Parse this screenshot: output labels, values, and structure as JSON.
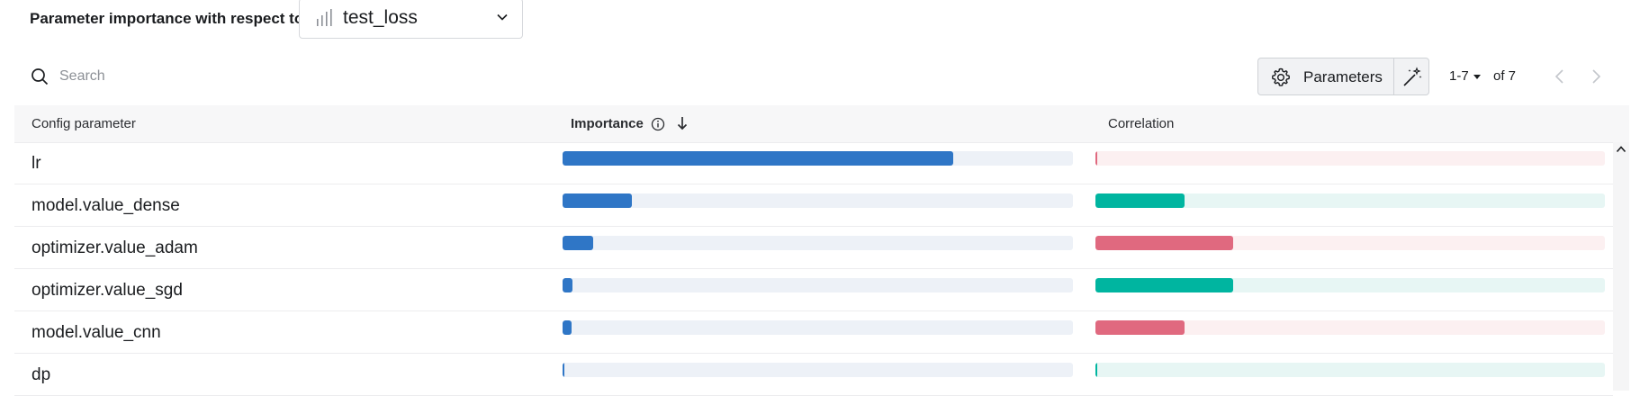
{
  "header": {
    "title": "Parameter importance with respect to",
    "metric": {
      "value": "test_loss",
      "icon": "bar-chart-icon"
    }
  },
  "toolbar": {
    "search_placeholder": "Search",
    "parameters_label": "Parameters",
    "pagination": {
      "range": "1-7",
      "of": "of 7"
    }
  },
  "table": {
    "columns": {
      "param": "Config parameter",
      "importance": "Importance",
      "correlation": "Correlation"
    },
    "rows": [
      {
        "name": "lr",
        "importance": 0.765,
        "correlation": -0.003
      },
      {
        "name": "model.value_dense",
        "importance": 0.135,
        "correlation": 0.175
      },
      {
        "name": "optimizer.value_adam",
        "importance": 0.06,
        "correlation": -0.27
      },
      {
        "name": "optimizer.value_sgd",
        "importance": 0.02,
        "correlation": 0.27
      },
      {
        "name": "model.value_cnn",
        "importance": 0.018,
        "correlation": -0.175
      },
      {
        "name": "dp",
        "importance": 0.004,
        "correlation": 0.003
      }
    ]
  },
  "colors": {
    "importance": "#2f76c6",
    "positive": "#00b5a0",
    "negative": "#e0697f"
  }
}
